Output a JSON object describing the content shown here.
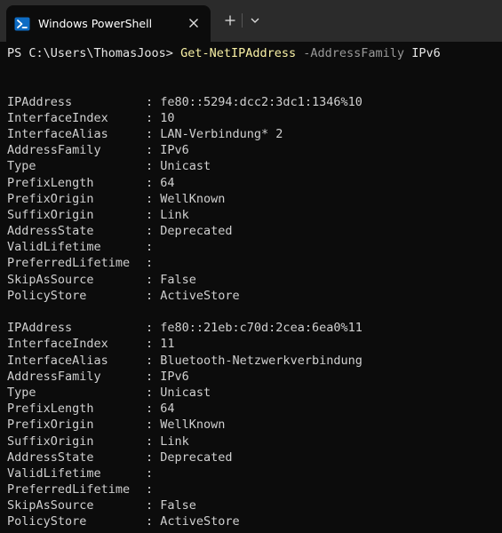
{
  "window": {
    "tab_title": "Windows PowerShell",
    "new_tab_symbol": "+",
    "icons": {
      "tab": "powershell-icon",
      "close": "close-icon",
      "new_tab": "plus-icon",
      "dropdown": "chevron-down-icon"
    }
  },
  "command": {
    "prompt": "PS C:\\Users\\ThomasJoos> ",
    "cmdlet": "Get-NetIPAddress",
    "parameter": "-AddressFamily",
    "argument": "IPv6"
  },
  "separator": ": ",
  "records": [
    {
      "fields": [
        {
          "key": "IPAddress",
          "value": "fe80::5294:dcc2:3dc1:1346%10"
        },
        {
          "key": "InterfaceIndex",
          "value": "10"
        },
        {
          "key": "InterfaceAlias",
          "value": "LAN-Verbindung* 2"
        },
        {
          "key": "AddressFamily",
          "value": "IPv6"
        },
        {
          "key": "Type",
          "value": "Unicast"
        },
        {
          "key": "PrefixLength",
          "value": "64"
        },
        {
          "key": "PrefixOrigin",
          "value": "WellKnown"
        },
        {
          "key": "SuffixOrigin",
          "value": "Link"
        },
        {
          "key": "AddressState",
          "value": "Deprecated"
        },
        {
          "key": "ValidLifetime",
          "value": ""
        },
        {
          "key": "PreferredLifetime",
          "value": ""
        },
        {
          "key": "SkipAsSource",
          "value": "False"
        },
        {
          "key": "PolicyStore",
          "value": "ActiveStore"
        }
      ]
    },
    {
      "fields": [
        {
          "key": "IPAddress",
          "value": "fe80::21eb:c70d:2cea:6ea0%11"
        },
        {
          "key": "InterfaceIndex",
          "value": "11"
        },
        {
          "key": "InterfaceAlias",
          "value": "Bluetooth-Netzwerkverbindung"
        },
        {
          "key": "AddressFamily",
          "value": "IPv6"
        },
        {
          "key": "Type",
          "value": "Unicast"
        },
        {
          "key": "PrefixLength",
          "value": "64"
        },
        {
          "key": "PrefixOrigin",
          "value": "WellKnown"
        },
        {
          "key": "SuffixOrigin",
          "value": "Link"
        },
        {
          "key": "AddressState",
          "value": "Deprecated"
        },
        {
          "key": "ValidLifetime",
          "value": ""
        },
        {
          "key": "PreferredLifetime",
          "value": ""
        },
        {
          "key": "SkipAsSource",
          "value": "False"
        },
        {
          "key": "PolicyStore",
          "value": "ActiveStore"
        }
      ]
    }
  ]
}
